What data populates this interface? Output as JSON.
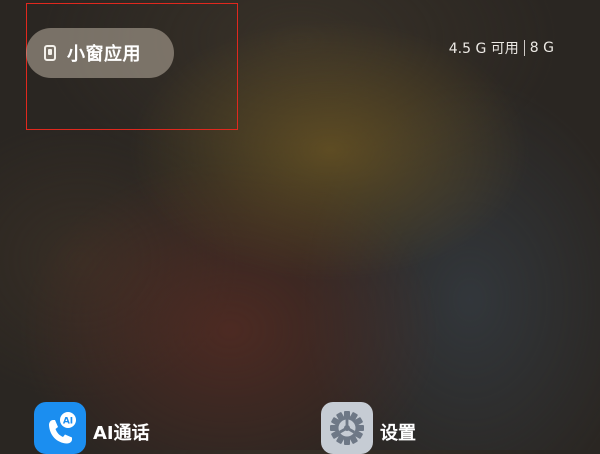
{
  "small_window_pill": {
    "label": "小窗应用",
    "icon": "small-window-icon"
  },
  "memory": {
    "available": "4.5 G 可用",
    "total": "8 G"
  },
  "apps": [
    {
      "label": "AI通话",
      "icon": "phone-ai-icon",
      "color": "#1b8ef0",
      "badge": "AI"
    },
    {
      "label": "设置",
      "icon": "gear-icon",
      "color": "#c6ccd4"
    }
  ],
  "colors": {
    "highlight_border": "#e0281e",
    "pill_background": "rgba(185,175,160,0.55)"
  }
}
